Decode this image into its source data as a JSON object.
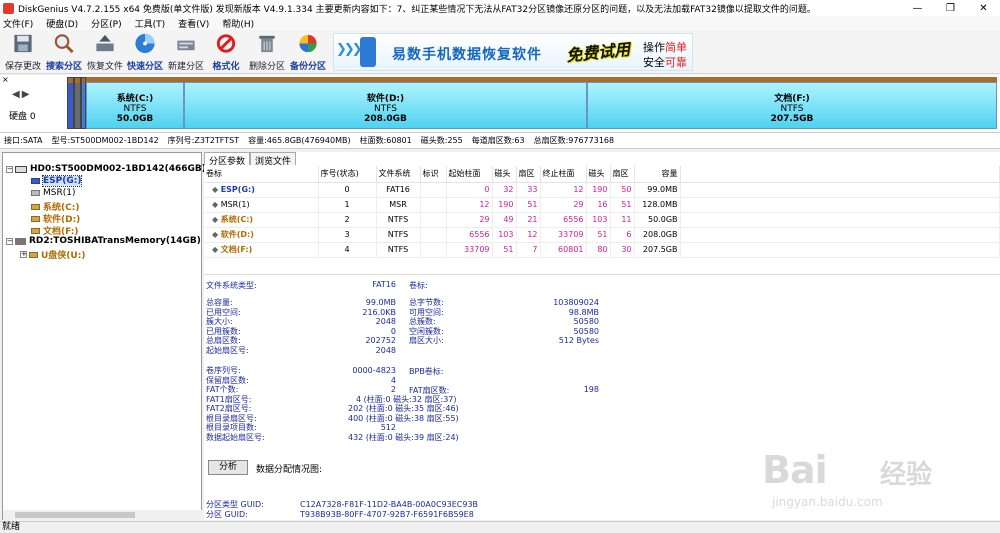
{
  "window": {
    "title": "DiskGenius V4.7.2.155 x64 免费版(单文件版)    发现新版本 V4.9.1.334 主要更新内容如下：7、纠正某些情况下无法从FAT32分区镜像还原分区的问题，以及无法加载FAT32镜像以提取文件的问题。",
    "minimize": "—",
    "maximize": "❐",
    "close": "✕"
  },
  "menu": [
    "文件(F)",
    "硬盘(D)",
    "分区(P)",
    "工具(T)",
    "查看(V)",
    "帮助(H)"
  ],
  "toolbar": [
    {
      "label": "保存更改",
      "icon": "save-icon",
      "bold": false
    },
    {
      "label": "搜索分区",
      "icon": "magnifier-icon",
      "bold": true
    },
    {
      "label": "恢复文件",
      "icon": "recover-icon",
      "bold": false
    },
    {
      "label": "快速分区",
      "icon": "quick-partition-icon",
      "bold": true
    },
    {
      "label": "新建分区",
      "icon": "new-partition-icon",
      "bold": false
    },
    {
      "label": "格式化",
      "icon": "format-icon",
      "bold": true
    },
    {
      "label": "删除分区",
      "icon": "trash-icon",
      "bold": false
    },
    {
      "label": "备份分区",
      "icon": "backup-icon",
      "bold": true
    }
  ],
  "banner": {
    "text": "易数手机数据恢复软件",
    "free": "免费试用",
    "line1a": "操作",
    "line1b": "简单",
    "line2a": "安全",
    "line2b": "可靠"
  },
  "diskmap": {
    "disk_label": "硬盘 0",
    "close": "×",
    "arrows": "◀▶",
    "segments": [
      {
        "name": "系统(C:)",
        "fs": "NTFS",
        "size": "50.0GB"
      },
      {
        "name": "软件(D:)",
        "fs": "NTFS",
        "size": "208.0GB"
      },
      {
        "name": "文档(F:)",
        "fs": "NTFS",
        "size": "207.5GB"
      }
    ]
  },
  "diskinfo": [
    "接口:SATA",
    "型号:ST500DM002-1BD142",
    "序列号:Z3T2TFTST",
    "容量:465.8GB(476940MB)",
    "柱面数:60801",
    "磁头数:255",
    "每道扇区数:63",
    "总扇区数:976773168"
  ],
  "tree": {
    "hd0": "HD0:ST500DM002-1BD142(466GB)",
    "hd0_items": [
      "ESP(G:)",
      "MSR(1)",
      "系统(C:)",
      "软件(D:)",
      "文档(F:)"
    ],
    "rd2": "RD2:TOSHIBATransMemory(14GB)",
    "rd2_items": [
      "U盘侠(U:)"
    ],
    "expand": "+",
    "collapse": "−"
  },
  "tabs": [
    "分区参数",
    "浏览文件"
  ],
  "ptable": {
    "headers": [
      "卷标",
      "序号(状态)",
      "文件系统",
      "标识",
      "起始柱面",
      "磁头",
      "扇区",
      "终止柱面",
      "磁头",
      "扇区",
      "容量"
    ],
    "rows": [
      [
        "ESP(G:)",
        "0",
        "FAT16",
        "",
        "0",
        "32",
        "33",
        "12",
        "190",
        "50",
        "99.0MB"
      ],
      [
        "MSR(1)",
        "1",
        "MSR",
        "",
        "12",
        "190",
        "51",
        "29",
        "16",
        "51",
        "128.0MB"
      ],
      [
        "系统(C:)",
        "2",
        "NTFS",
        "",
        "29",
        "49",
        "21",
        "6556",
        "103",
        "11",
        "50.0GB"
      ],
      [
        "软件(D:)",
        "3",
        "NTFS",
        "",
        "6556",
        "103",
        "12",
        "33709",
        "51",
        "6",
        "208.0GB"
      ],
      [
        "文档(F:)",
        "4",
        "NTFS",
        "",
        "33709",
        "51",
        "7",
        "60801",
        "80",
        "30",
        "207.5GB"
      ]
    ]
  },
  "fsinfo": {
    "fstype_k": "文件系统类型:",
    "fstype_v": "FAT16",
    "label_k": "卷标:",
    "left": [
      {
        "k": "总容量:",
        "v": "99.0MB"
      },
      {
        "k": "已用空间:",
        "v": "216.0KB"
      },
      {
        "k": "簇大小:",
        "v": "2048"
      },
      {
        "k": "已用簇数:",
        "v": "0"
      },
      {
        "k": "总扇区数:",
        "v": "202752"
      },
      {
        "k": "起始扇区号:",
        "v": "2048"
      }
    ],
    "right": [
      {
        "k": "总字节数:",
        "v": "103809024"
      },
      {
        "k": "可用空间:",
        "v": "98.8MB"
      },
      {
        "k": "总簇数:",
        "v": "50580"
      },
      {
        "k": "空闲簇数:",
        "v": "50580"
      },
      {
        "k": "扇区大小:",
        "v": "512 Bytes"
      }
    ],
    "bpb": [
      {
        "k": "卷序列号:",
        "v": "0000-4823"
      },
      {
        "k": "保留扇区数:",
        "v": "4"
      },
      {
        "k": "FAT个数:",
        "v": "2"
      },
      {
        "k": "FAT1扇区号:",
        "v": "4 (柱面:0 磁头:32 扇区:37)"
      },
      {
        "k": "FAT2扇区号:",
        "v": "202 (柱面:0 磁头:35 扇区:46)"
      },
      {
        "k": "根目录扇区号:",
        "v": "400 (柱面:0 磁头:38 扇区:55)"
      },
      {
        "k": "根目录项目数:",
        "v": "512"
      },
      {
        "k": "数据起始扇区号:",
        "v": "432 (柱面:0 磁头:39 扇区:24)"
      }
    ],
    "bpb_label": "BPB卷标:",
    "fat_sectors_k": "FAT扇区数:",
    "fat_sectors_v": "198"
  },
  "analyze_button": "分析",
  "analyze_label": "数据分配情况图:",
  "guid": {
    "type_k": "分区类型 GUID:",
    "type_v": "C12A7328-F81F-11D2-BA4B-00A0C93EC93B",
    "part_k": "分区 GUID:",
    "part_v": "T938B93B-80FF-4707-92B7-F6591F6B59E8"
  },
  "status": "就绪",
  "watermark": {
    "brand": "Bai",
    "cn": "经验",
    "url": "jingyan.baidu.com"
  }
}
